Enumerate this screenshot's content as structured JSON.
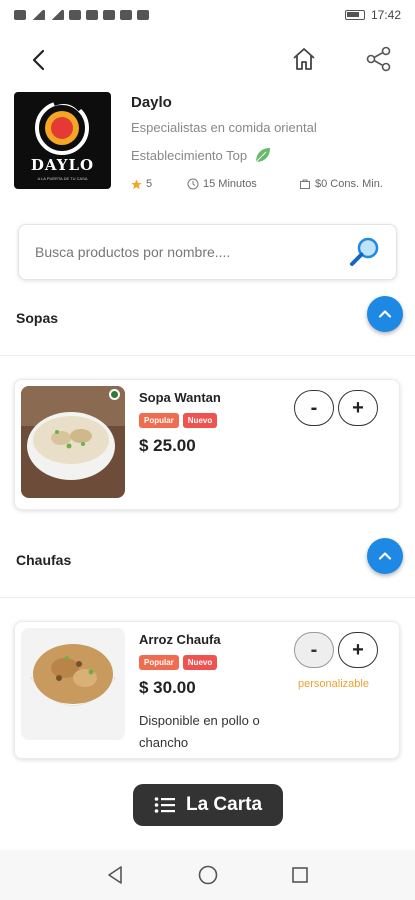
{
  "status_bar": {
    "time": "17:42"
  },
  "store": {
    "name": "Daylo",
    "logo_text": "DAYLO",
    "logo_tagline": "A LA PUERTA DE TU CASA",
    "description": "Especialistas en comida oriental",
    "badge": "Establecimiento Top",
    "rating": "5",
    "delivery_time": "15 Minutos",
    "min_order": "$0 Cons. Min."
  },
  "search": {
    "placeholder": "Busca productos por nombre...."
  },
  "sections": [
    {
      "title": "Sopas",
      "products": [
        {
          "name": "Sopa Wantan",
          "badges": [
            "Popular",
            "Nuevo"
          ],
          "price": "$ 25.00",
          "minus": "-",
          "plus": "+"
        }
      ]
    },
    {
      "title": "Chaufas",
      "products": [
        {
          "name": "Arroz Chaufa",
          "badges": [
            "Popular",
            "Nuevo"
          ],
          "price": "$ 30.00",
          "minus": "-",
          "plus": "+",
          "note": "personalizable",
          "description": "Disponible en pollo o chancho"
        }
      ]
    }
  ],
  "menu_button": {
    "label": "La Carta"
  },
  "colors": {
    "accent": "#1e88e5",
    "badge": "#ef5350",
    "highlight": "#f0a030",
    "dark_button": "#333333"
  }
}
